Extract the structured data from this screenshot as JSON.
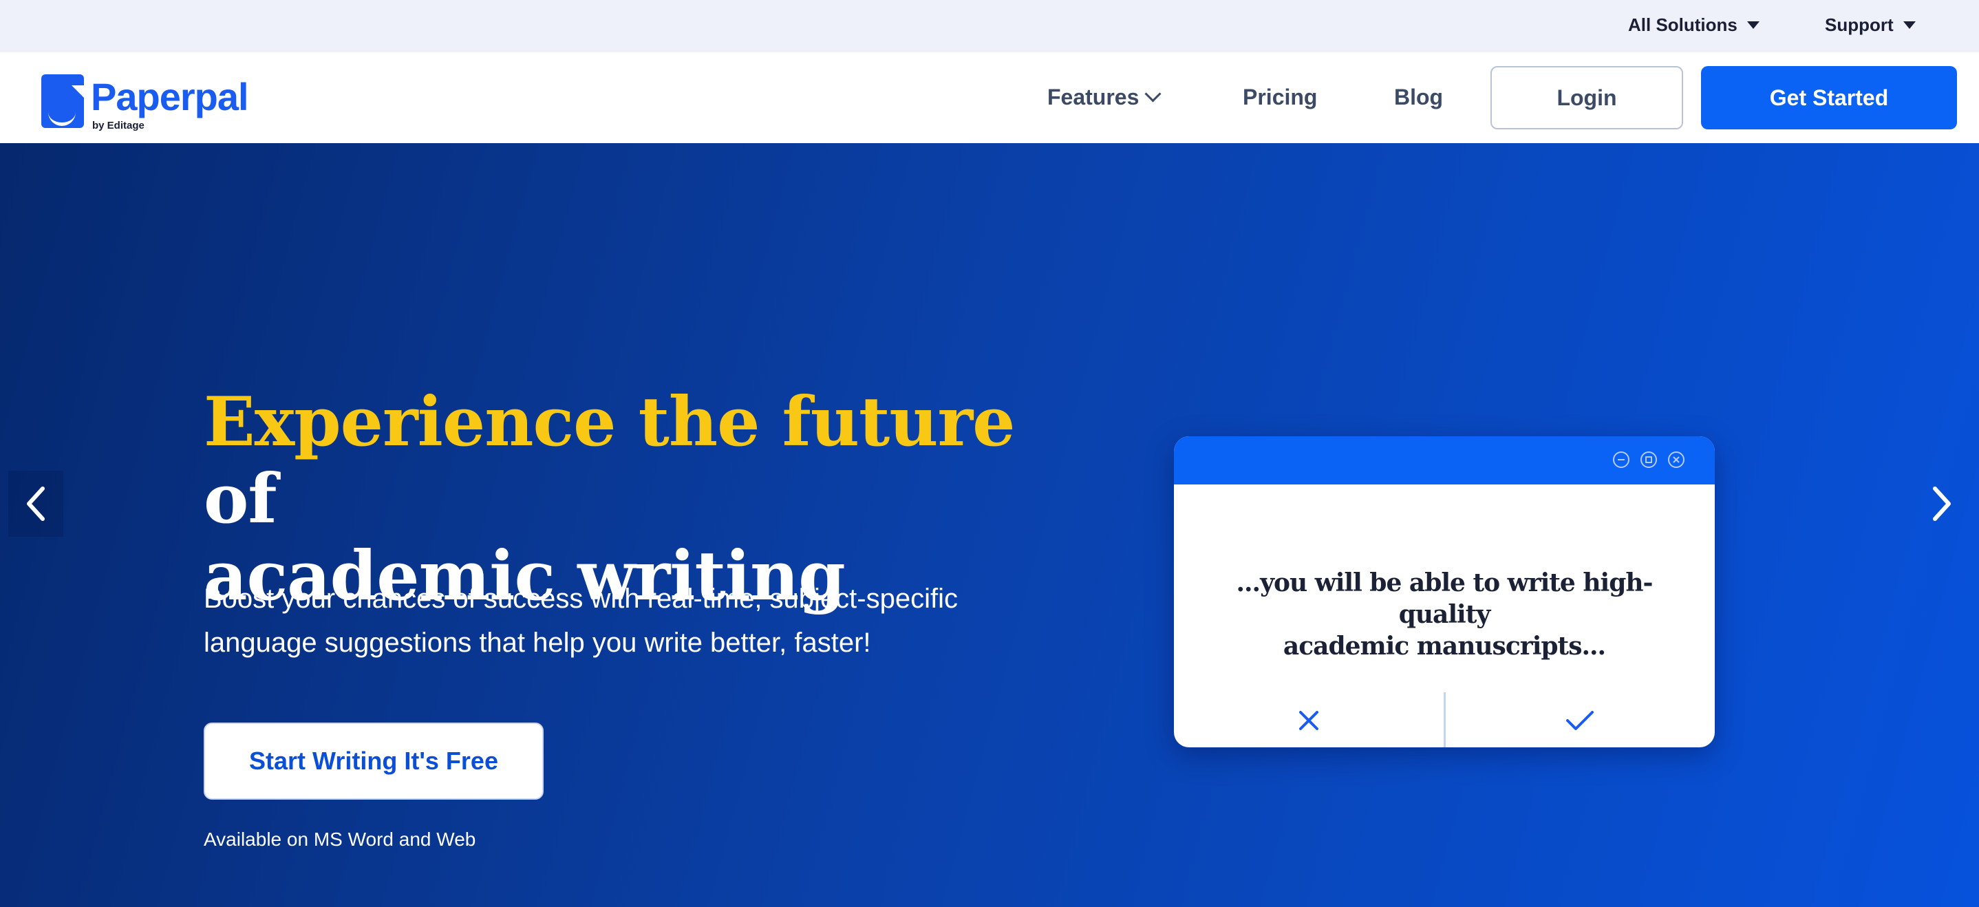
{
  "topbar": {
    "all_solutions": "All Solutions",
    "support": "Support"
  },
  "nav": {
    "logo_text": "Paperpal",
    "logo_sub": "by Editage",
    "features": "Features",
    "pricing": "Pricing",
    "blog": "Blog",
    "login": "Login",
    "get_started": "Get Started"
  },
  "hero": {
    "title_highlight": "Experience the future",
    "title_rest_line1": " of",
    "title_line2": "academic writing",
    "subtitle_line1": "Boost your chances of success with real-time, subject-specific",
    "subtitle_line2": "language suggestions that help you write better, faster!",
    "cta_label": "Start Writing It's Free",
    "availability": "Available on MS Word and Web",
    "highlight_color": "#f8c814",
    "background_colors": [
      "#06286e",
      "#0752dc"
    ]
  },
  "mock_window": {
    "text_line1": "...you will be able to write high-quality",
    "text_line2": "academic manuscripts...",
    "reject_icon": "x-icon",
    "accept_icon": "check-icon",
    "bar_color": "#0b63f6"
  },
  "carousel": {
    "prev_icon": "chevron-left-icon",
    "next_icon": "chevron-right-icon"
  }
}
